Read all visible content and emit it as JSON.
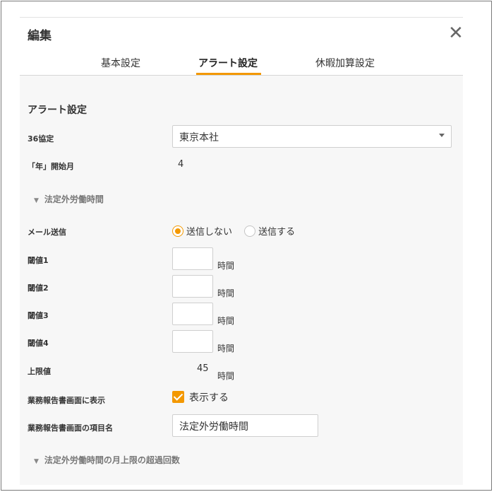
{
  "dialog": {
    "title": "編集",
    "close_glyph": "✕"
  },
  "tabs": [
    {
      "label": "基本設定",
      "active": false
    },
    {
      "label": "アラート設定",
      "active": true
    },
    {
      "label": "休暇加算設定",
      "active": false
    }
  ],
  "colors": {
    "accent": "#f39800"
  },
  "alert": {
    "section_title": "アラート設定",
    "agreement_label": "36協定",
    "agreement_value": "東京本社",
    "year_start_label": "「年」開始月",
    "year_start_value": "4",
    "overtime_section": "法定外労働時間",
    "mail_label": "メール送信",
    "mail_options": [
      "送信しない",
      "送信する"
    ],
    "mail_selected": "送信しない",
    "thresholds": [
      {
        "label": "閾値1",
        "value": "",
        "unit": "時間"
      },
      {
        "label": "閾値2",
        "value": "",
        "unit": "時間"
      },
      {
        "label": "閾値3",
        "value": "",
        "unit": "時間"
      },
      {
        "label": "閾値4",
        "value": "",
        "unit": "時間"
      }
    ],
    "limit_label": "上限値",
    "limit_value": "45",
    "limit_unit": "時間",
    "display_label": "業務報告書画面に表示",
    "display_checkbox_label": "表示する",
    "display_checked": true,
    "item_name_label": "業務報告書画面の項目名",
    "item_name_value": "法定外労働時間",
    "monthly_section": "法定外労働時間の月上限の超過回数"
  }
}
